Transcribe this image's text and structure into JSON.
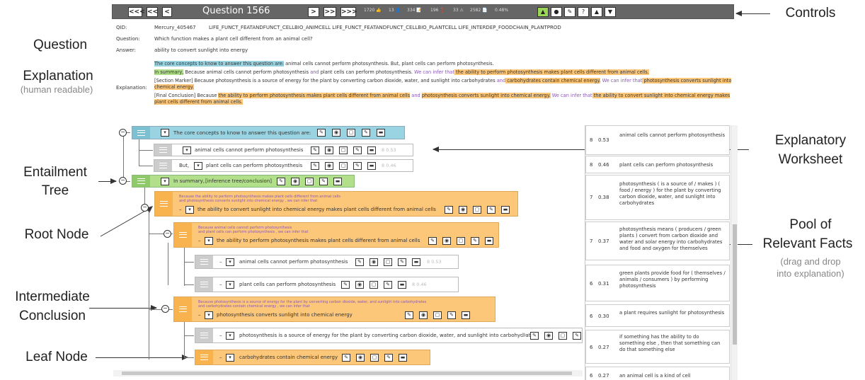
{
  "side_labels": {
    "question": "Question",
    "explanation": "Explanation",
    "explanation_sub": "(human readable)",
    "entailment_tree_1": "Entailment",
    "entailment_tree_2": "Tree",
    "root_node": "Root Node",
    "intermediate_1": "Intermediate",
    "intermediate_2": "Conclusion",
    "leaf_node": "Leaf Node",
    "controls": "Controls",
    "worksheet_1": "Explanatory",
    "worksheet_2": "Worksheet",
    "pool_1": "Pool of",
    "pool_2": "Relevant Facts",
    "pool_sub_1": "(drag and drop",
    "pool_sub_2": "into explanation)"
  },
  "toolbar": {
    "first": "<<<",
    "prev10": "<<",
    "prev": "<",
    "title": "Question   1566",
    "next": ">",
    "next10": ">>",
    "last": ">>>",
    "stats": [
      "1720 👍",
      "13 👤",
      "334 📝",
      "196 ❓",
      "33 ⚠",
      "2582 📄",
      "0.48%"
    ],
    "icons": [
      "thumbs-up",
      "user-check",
      "edit",
      "help",
      "warning",
      "pin"
    ]
  },
  "question": {
    "qid_label": "QID:",
    "qid": "Mercury_405467",
    "qid_tags": "LIFE_FUNCT_FEATANDFUNCT_CELLBIO_ANIMCELL LIFE_FUNCT_FEATANDFUNCT_CELLBIO_PLANTCELL LIFE_INTERDEP_FOODCHAIN_PLANTPROD",
    "question_label": "Question:",
    "question": "Which function makes a plant cell different from an animal cell?",
    "answer_label": "Answer:",
    "answer": "ability to convert sunlight into energy",
    "explanation_label": "Explanation:"
  },
  "explanation": {
    "l1_hl": "The core concepts to know to answer this question are:",
    "l1_rest": " animal cells cannot perform photosynthesis. But, plant cells can perform photosynthesis.",
    "l2_hl": "In summary,",
    "l2_a": " Because animal cells cannot perform photosynthesis ",
    "l2_and": "and",
    "l2_b": " plant cells can perform photosynthesis. ",
    "l2_infer": "We can infer that",
    "l2_c": " the ability to perform photosynthesis makes plant cells different from animal cells.",
    "l3_a": "[Section Marker] Because photosynthesis is a source of energy for the plant by converting carbon dioxide, water, and sunlight into carbohydrates ",
    "l3_and": "and",
    "l3_b": " carbohydrates contain chemical energy.",
    "l3_infer": " We can infer that",
    "l3_c": " photosynthesis converts sunlight into chemical energy.",
    "l4_a": "[Final Conclusion] Because ",
    "l4_b": "the ability to perform photosynthesis makes plant cells different from animal cells",
    "l4_and": " and ",
    "l4_c": "photosynthesis converts sunlight into chemical energy.",
    "l4_infer": " We can infer that",
    "l4_d": " the ability to convert sunlight into chemical energy makes plant cells different from animal cells."
  },
  "tree": {
    "core_label": "The core concepts to know to answer this question are:",
    "leaf1": "animal cells cannot perform photosynthesis",
    "leaf1_score": "8  0.53",
    "but": "But,",
    "leaf2": "plant cells can perform photosynthesis",
    "leaf2_score": "8  0.46",
    "summary": "In summary,",
    "summary_hint": "[inference tree/conclusion]",
    "root_sup1": "Because the ability to perform photosynthesis makes plant cells different from animal cells",
    "root_sup2": "and photosynthesis converts sunlight into chemical energy , we can infer that",
    "root_text": "the ability to convert sunlight into chemical energy makes plant cells different from animal cells",
    "int1_sup1": "Because animal cells cannot perform photosynthesis",
    "int1_sup2": "and plant cells can perform photosynthesis , we can infer that",
    "int1_text": "the ability to perform photosynthesis makes plant cells different from animal cells",
    "int1_leaf1": "animal cells cannot perform photosynthesis",
    "int1_leaf1_score": "8  0.53",
    "int1_leaf2": "plant cells can perform photosynthesis",
    "int1_leaf2_score": "8  0.46",
    "int2_sup1": "Because photosynthesis is a source of energy for the plant by converting carbon dioxide, water, and sunlight into carbohydrates",
    "int2_sup2": "and carbohydrates contain chemical energy , we can infer that",
    "int2_text": "photosynthesis converts sunlight into chemical energy",
    "int2_leaf1": "photosynthesis is a source of energy for the plant by converting carbon dioxide, water, and sunlight into carbohydrates",
    "int2_leaf2": "carbohydrates contain chemical energy"
  },
  "pool": [
    {
      "n": "8",
      "s": "0.53",
      "t": "animal cells cannot perform photosynthesis"
    },
    {
      "n": "8",
      "s": "0.46",
      "t": "plant cells can perform photosynthesis"
    },
    {
      "n": "7",
      "s": "0.38",
      "t": "photosynthesis ( is a source of / makes ) ( food / energy ) for the plant by converting carbon dioxide, water, and sunlight into carbohydrates"
    },
    {
      "n": "7",
      "s": "0.37",
      "t": "photosynthesis means ( producers / green plants ) convert from carbon dioxide and water and solar energy into carbohydrates and food and oxygen for themselves"
    },
    {
      "n": "6",
      "s": "0.31",
      "t": "green plants provide food for ( themselves / animals / consumers ) by performing photosynthesis"
    },
    {
      "n": "6",
      "s": "0.30",
      "t": "a plant requires sunlight for photosynthesis"
    },
    {
      "n": "6",
      "s": "0.27",
      "t": "if something has the ability to do something else , then that something can do that something else"
    },
    {
      "n": "6",
      "s": "0.27",
      "t": "an animal cell is a kind of cell"
    }
  ]
}
